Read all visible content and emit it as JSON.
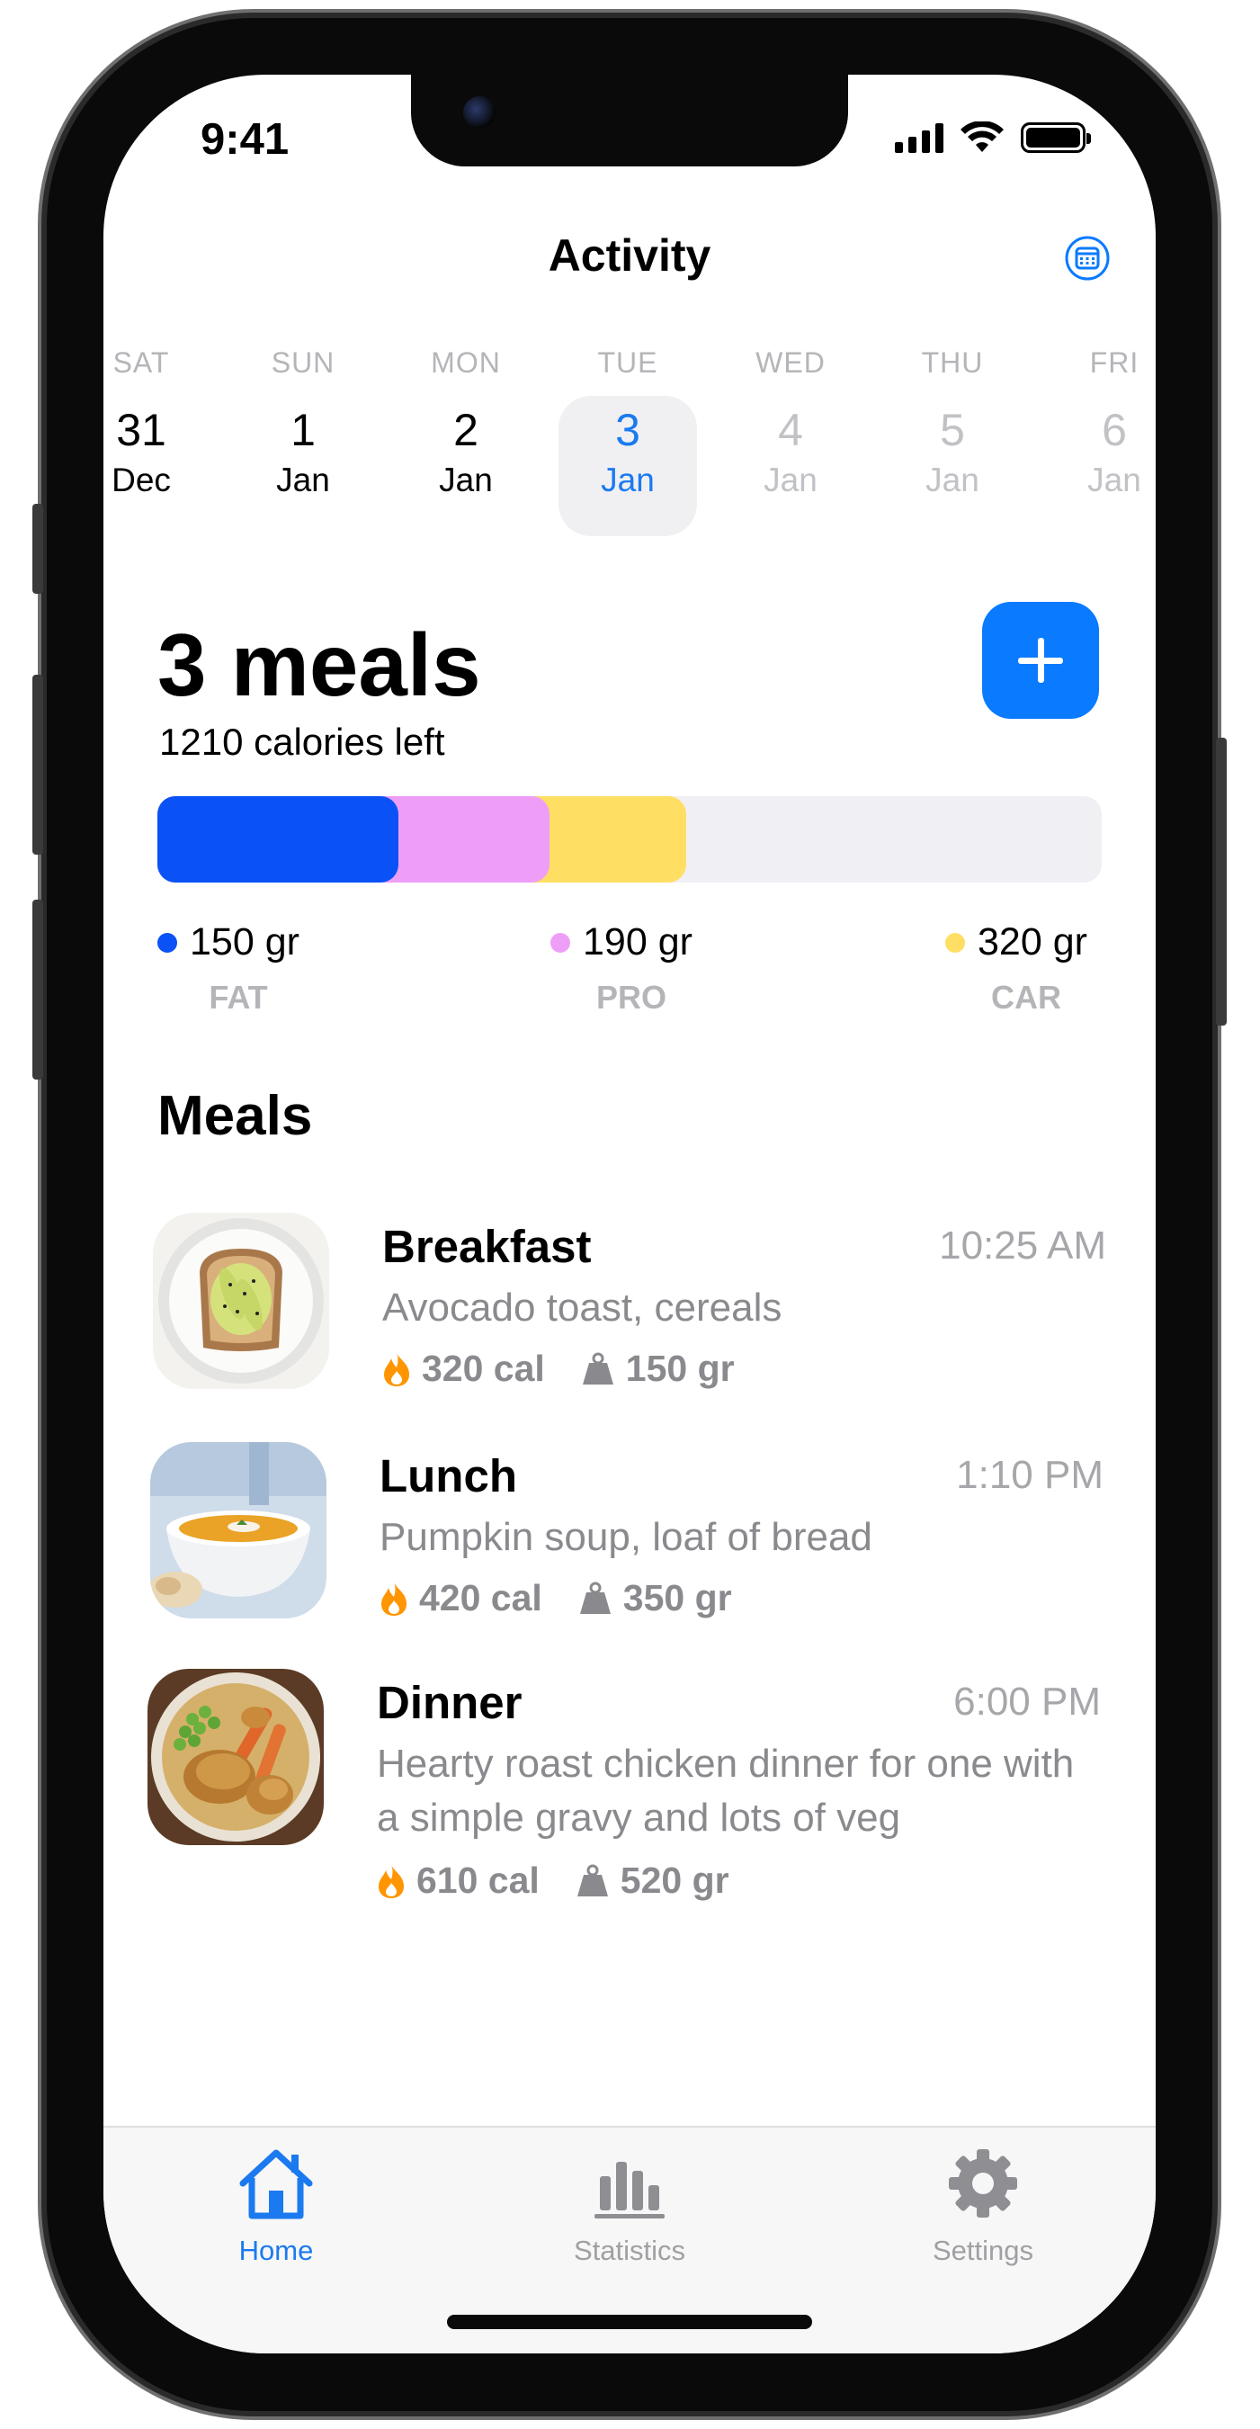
{
  "status_bar": {
    "time": "9:41"
  },
  "header": {
    "title": "Activity",
    "calendar_icon": "calendar-icon"
  },
  "days": [
    {
      "dow": "SAT",
      "num": "31",
      "mon": "Dec",
      "state": "past"
    },
    {
      "dow": "SUN",
      "num": "1",
      "mon": "Jan",
      "state": "past"
    },
    {
      "dow": "MON",
      "num": "2",
      "mon": "Jan",
      "state": "past"
    },
    {
      "dow": "TUE",
      "num": "3",
      "mon": "Jan",
      "state": "selected"
    },
    {
      "dow": "WED",
      "num": "4",
      "mon": "Jan",
      "state": "future"
    },
    {
      "dow": "THU",
      "num": "5",
      "mon": "Jan",
      "state": "future"
    },
    {
      "dow": "FRI",
      "num": "6",
      "mon": "Jan",
      "state": "future"
    }
  ],
  "summary": {
    "meals_count": "3 meals",
    "calories_left": "1210 calories left"
  },
  "macros": [
    {
      "value": "150 gr",
      "label": "FAT",
      "color": "#0a52f5",
      "fill_fraction": 0.255
    },
    {
      "value": "190 gr",
      "label": "PRO",
      "color": "#ef9ef8",
      "fill_fraction": 0.16
    },
    {
      "value": "320 gr",
      "label": "CAR",
      "color": "#ffde64",
      "fill_fraction": 0.145
    }
  ],
  "meals_heading": "Meals",
  "meals": [
    {
      "name": "Breakfast",
      "time": "10:25 AM",
      "description": "Avocado toast, cereals",
      "calories": "320 cal",
      "weight": "150 gr",
      "image": "avocado-toast-photo"
    },
    {
      "name": "Lunch",
      "time": "1:10 PM",
      "description": "Pumpkin soup, loaf of bread",
      "calories": "420 cal",
      "weight": "350 gr",
      "image": "pumpkin-soup-photo"
    },
    {
      "name": "Dinner",
      "time": "6:00 PM",
      "description": "Hearty roast chicken dinner for one with a simple gravy and lots of veg",
      "calories": "610 cal",
      "weight": "520 gr",
      "image": "roast-chicken-photo"
    }
  ],
  "tabs": [
    {
      "label": "Home",
      "icon": "house-icon",
      "active": true
    },
    {
      "label": "Statistics",
      "icon": "bar-chart-icon",
      "active": false
    },
    {
      "label": "Settings",
      "icon": "gear-icon",
      "active": false
    }
  ],
  "colors": {
    "accent": "#0a7aff",
    "selected_day_text": "#1b7af0",
    "flame": "#ff9500"
  }
}
